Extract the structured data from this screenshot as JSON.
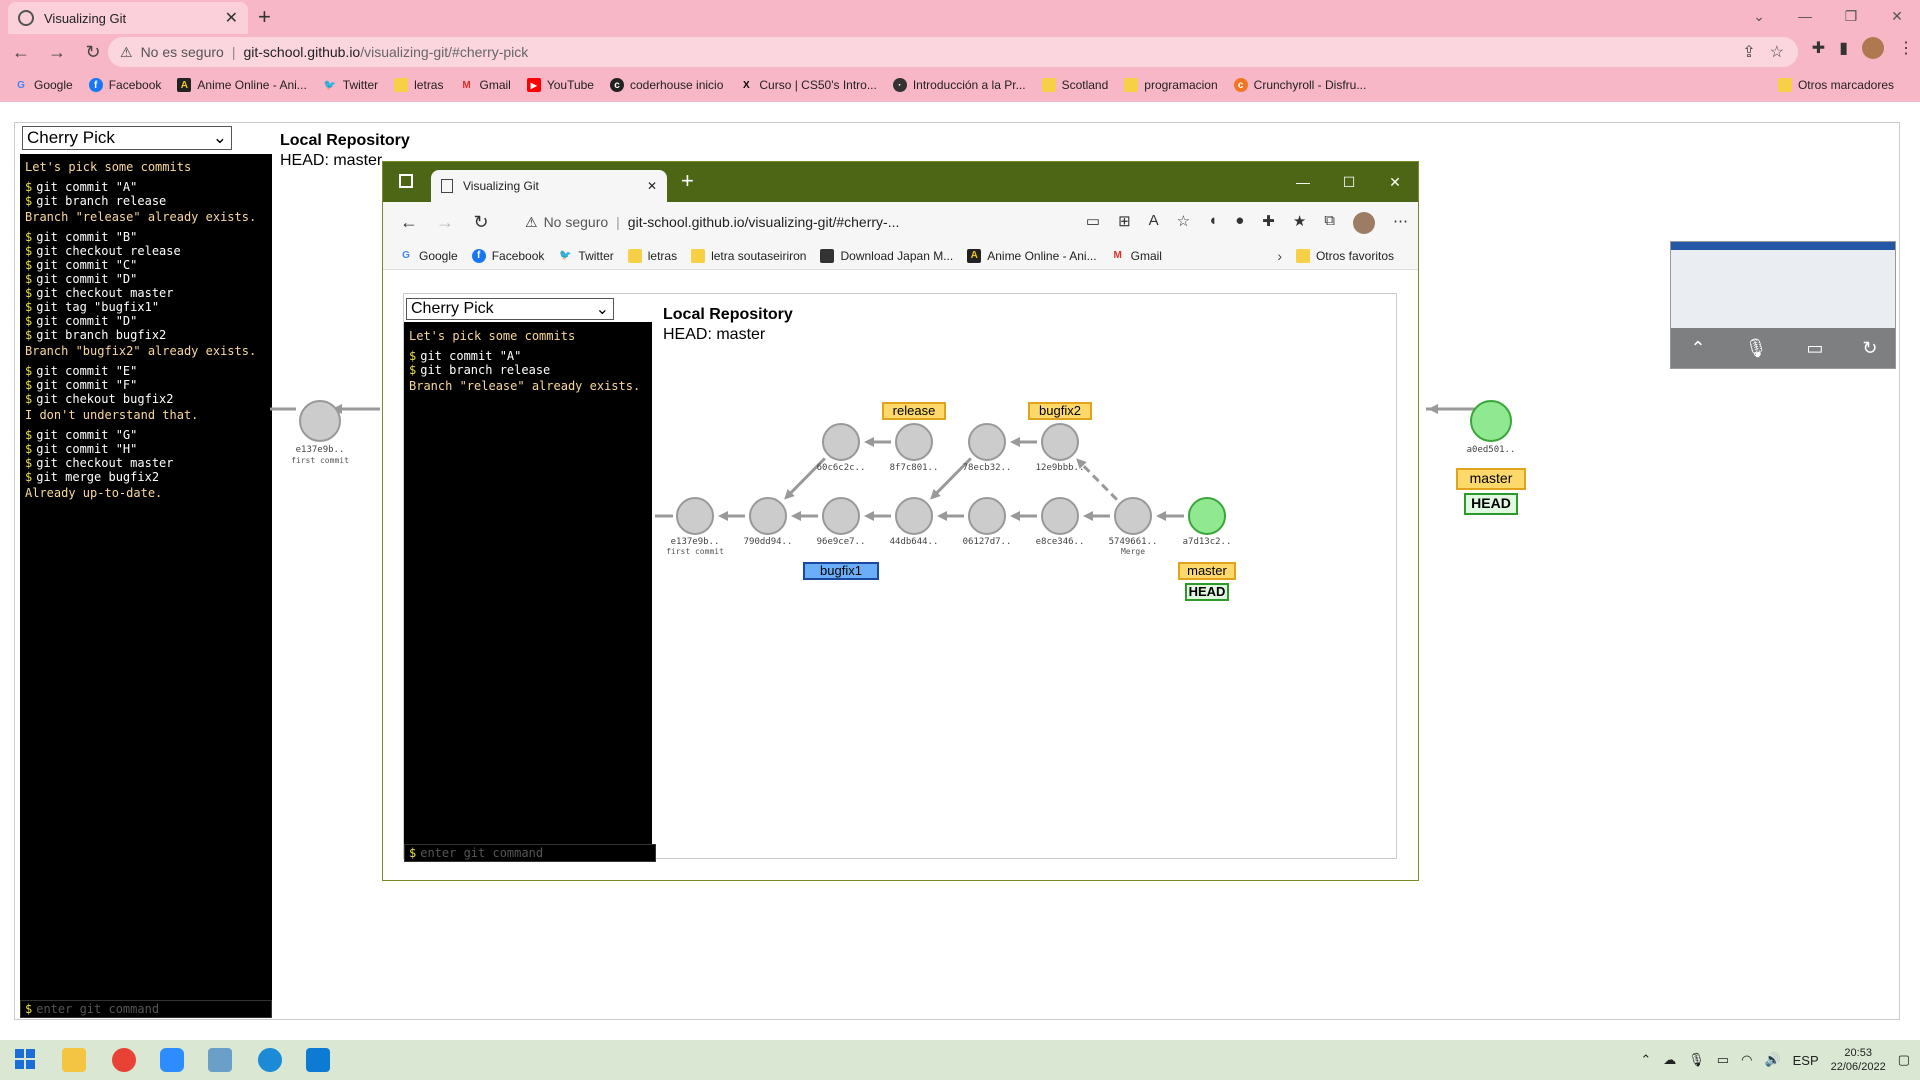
{
  "browser": {
    "tab_title": "Visualizing Git",
    "security": "No es seguro",
    "url_host": "git-school.github.io",
    "url_path": "/visualizing-git/#cherry-pick",
    "bookmarks": [
      "Google",
      "Facebook",
      "Anime Online - Ani...",
      "Twitter",
      "letras",
      "Gmail",
      "YouTube",
      "coderhouse inicio",
      "Curso | CS50's Intro...",
      "Introducción a la Pr...",
      "Scotland",
      "programacion",
      "Crunchyroll - Disfru..."
    ],
    "other_bookmarks": "Otros marcadores"
  },
  "outer_app": {
    "scenario": "Cherry Pick",
    "repo_title": "Local Repository",
    "head": "HEAD: master",
    "terminal_lines": [
      {
        "type": "info",
        "text": "Let's pick some commits"
      },
      {
        "type": "cmd",
        "text": "git commit \"A\""
      },
      {
        "type": "cmd",
        "text": "git branch release"
      },
      {
        "type": "info",
        "text": "Branch \"release\" already exists."
      },
      {
        "type": "cmd",
        "text": "git commit \"B\""
      },
      {
        "type": "cmd",
        "text": "git checkout release"
      },
      {
        "type": "cmd",
        "text": "git commit \"C\""
      },
      {
        "type": "cmd",
        "text": "git commit \"D\""
      },
      {
        "type": "cmd",
        "text": "git checkout master"
      },
      {
        "type": "cmd",
        "text": "git tag \"bugfix1\""
      },
      {
        "type": "cmd",
        "text": "git commit \"D\""
      },
      {
        "type": "cmd",
        "text": "git branch bugfix2"
      },
      {
        "type": "info",
        "text": "Branch \"bugfix2\" already exists."
      },
      {
        "type": "cmd",
        "text": "git commit \"E\""
      },
      {
        "type": "cmd",
        "text": "git commit \"F\""
      },
      {
        "type": "cmd",
        "text": "git chekout bugfix2"
      },
      {
        "type": "info",
        "text": "I don't understand that."
      },
      {
        "type": "cmd",
        "text": "git commit \"G\""
      },
      {
        "type": "cmd",
        "text": "git commit \"H\""
      },
      {
        "type": "cmd",
        "text": "git checkout master"
      },
      {
        "type": "cmd",
        "text": "git merge bugfix2"
      },
      {
        "type": "info",
        "text": "Already up-to-date."
      }
    ],
    "input_placeholder": "enter git command",
    "first_commit_id": "e137e9b..",
    "first_commit_msg": "first commit",
    "tip_commit_id": "a0ed501..",
    "branch_master": "master",
    "head_tag": "HEAD",
    "partial_id": ".."
  },
  "inner_browser": {
    "tab_title": "Visualizing Git",
    "security": "No seguro",
    "url": "git-school.github.io/visualizing-git/#cherry-...",
    "bookmarks": [
      "Google",
      "Facebook",
      "Twitter",
      "letras",
      "letra soutaseiriron",
      "Download Japan M...",
      "Anime Online - Ani...",
      "Gmail"
    ],
    "other_bookmarks": "Otros favoritos"
  },
  "inner_app": {
    "scenario": "Cherry Pick",
    "repo_title": "Local Repository",
    "head": "HEAD: master",
    "terminal_lines": [
      {
        "type": "info",
        "text": "Let's pick some commits"
      },
      {
        "type": "cmd",
        "text": "git commit \"A\""
      },
      {
        "type": "cmd",
        "text": "git branch release"
      },
      {
        "type": "info",
        "text": "Branch \"release\" already exists."
      }
    ],
    "input_placeholder": "enter git command",
    "commits": [
      {
        "id": "e137e9b..",
        "msg": "first commit",
        "color": "gray"
      },
      {
        "id": "790dd94..",
        "msg": "",
        "color": "gray"
      },
      {
        "id": "96e9ce7..",
        "msg": "",
        "color": "gray"
      },
      {
        "id": "44db644..",
        "msg": "",
        "color": "gray"
      },
      {
        "id": "06127d7..",
        "msg": "",
        "color": "gray"
      },
      {
        "id": "e8ce346..",
        "msg": "",
        "color": "gray"
      },
      {
        "id": "5749661..",
        "msg": "Merge",
        "color": "gray"
      },
      {
        "id": "a7d13c2..",
        "msg": "",
        "color": "green"
      },
      {
        "id": "60c6c2c..",
        "msg": "",
        "color": "gray"
      },
      {
        "id": "8f7c801..",
        "msg": "",
        "color": "gray"
      },
      {
        "id": "78ecb32..",
        "msg": "",
        "color": "gray"
      },
      {
        "id": "12e9bbb..",
        "msg": "",
        "color": "gray"
      }
    ],
    "branches": [
      {
        "name": "release",
        "color": "yellow"
      },
      {
        "name": "bugfix2",
        "color": "yellow"
      },
      {
        "name": "bugfix1",
        "color": "blue"
      },
      {
        "name": "master",
        "color": "yellow"
      }
    ],
    "head_tag": "HEAD"
  },
  "taskbar": {
    "language": "ESP",
    "time": "20:53",
    "date": "22/06/2022"
  },
  "colors": {
    "outer_chrome": "#f8b7c6",
    "inner_chrome": "#4d6615",
    "commit_gray": "#cccccc",
    "commit_head": "#90e890",
    "branch_yellow": "#fcd96a",
    "branch_blue": "#69aef7",
    "terminal_bg": "#000000",
    "terminal_info": "#f9d89a"
  }
}
